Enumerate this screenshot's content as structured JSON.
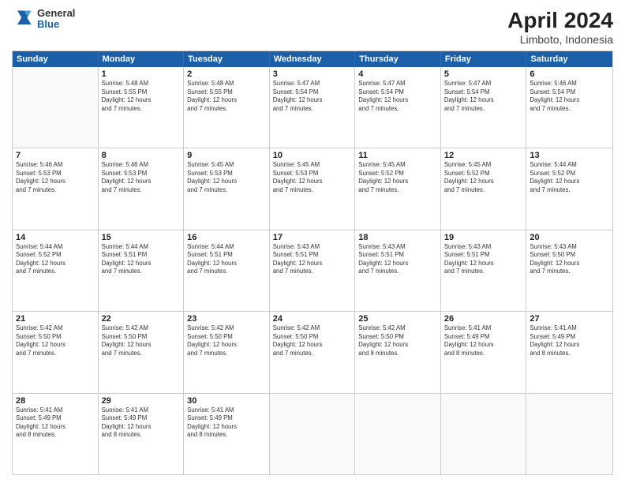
{
  "header": {
    "logo_general": "General",
    "logo_blue": "Blue",
    "title": "April 2024",
    "subtitle": "Limboto, Indonesia"
  },
  "days_of_week": [
    "Sunday",
    "Monday",
    "Tuesday",
    "Wednesday",
    "Thursday",
    "Friday",
    "Saturday"
  ],
  "weeks": [
    [
      {
        "day": "",
        "text": ""
      },
      {
        "day": "1",
        "text": "Sunrise: 5:48 AM\nSunset: 5:55 PM\nDaylight: 12 hours\nand 7 minutes."
      },
      {
        "day": "2",
        "text": "Sunrise: 5:48 AM\nSunset: 5:55 PM\nDaylight: 12 hours\nand 7 minutes."
      },
      {
        "day": "3",
        "text": "Sunrise: 5:47 AM\nSunset: 5:54 PM\nDaylight: 12 hours\nand 7 minutes."
      },
      {
        "day": "4",
        "text": "Sunrise: 5:47 AM\nSunset: 5:54 PM\nDaylight: 12 hours\nand 7 minutes."
      },
      {
        "day": "5",
        "text": "Sunrise: 5:47 AM\nSunset: 5:54 PM\nDaylight: 12 hours\nand 7 minutes."
      },
      {
        "day": "6",
        "text": "Sunrise: 5:46 AM\nSunset: 5:54 PM\nDaylight: 12 hours\nand 7 minutes."
      }
    ],
    [
      {
        "day": "7",
        "text": "Sunrise: 5:46 AM\nSunset: 5:53 PM\nDaylight: 12 hours\nand 7 minutes."
      },
      {
        "day": "8",
        "text": "Sunrise: 5:46 AM\nSunset: 5:53 PM\nDaylight: 12 hours\nand 7 minutes."
      },
      {
        "day": "9",
        "text": "Sunrise: 5:45 AM\nSunset: 5:53 PM\nDaylight: 12 hours\nand 7 minutes."
      },
      {
        "day": "10",
        "text": "Sunrise: 5:45 AM\nSunset: 5:53 PM\nDaylight: 12 hours\nand 7 minutes."
      },
      {
        "day": "11",
        "text": "Sunrise: 5:45 AM\nSunset: 5:52 PM\nDaylight: 12 hours\nand 7 minutes."
      },
      {
        "day": "12",
        "text": "Sunrise: 5:45 AM\nSunset: 5:52 PM\nDaylight: 12 hours\nand 7 minutes."
      },
      {
        "day": "13",
        "text": "Sunrise: 5:44 AM\nSunset: 5:52 PM\nDaylight: 12 hours\nand 7 minutes."
      }
    ],
    [
      {
        "day": "14",
        "text": "Sunrise: 5:44 AM\nSunset: 5:52 PM\nDaylight: 12 hours\nand 7 minutes."
      },
      {
        "day": "15",
        "text": "Sunrise: 5:44 AM\nSunset: 5:51 PM\nDaylight: 12 hours\nand 7 minutes."
      },
      {
        "day": "16",
        "text": "Sunrise: 5:44 AM\nSunset: 5:51 PM\nDaylight: 12 hours\nand 7 minutes."
      },
      {
        "day": "17",
        "text": "Sunrise: 5:43 AM\nSunset: 5:51 PM\nDaylight: 12 hours\nand 7 minutes."
      },
      {
        "day": "18",
        "text": "Sunrise: 5:43 AM\nSunset: 5:51 PM\nDaylight: 12 hours\nand 7 minutes."
      },
      {
        "day": "19",
        "text": "Sunrise: 5:43 AM\nSunset: 5:51 PM\nDaylight: 12 hours\nand 7 minutes."
      },
      {
        "day": "20",
        "text": "Sunrise: 5:43 AM\nSunset: 5:50 PM\nDaylight: 12 hours\nand 7 minutes."
      }
    ],
    [
      {
        "day": "21",
        "text": "Sunrise: 5:42 AM\nSunset: 5:50 PM\nDaylight: 12 hours\nand 7 minutes."
      },
      {
        "day": "22",
        "text": "Sunrise: 5:42 AM\nSunset: 5:50 PM\nDaylight: 12 hours\nand 7 minutes."
      },
      {
        "day": "23",
        "text": "Sunrise: 5:42 AM\nSunset: 5:50 PM\nDaylight: 12 hours\nand 7 minutes."
      },
      {
        "day": "24",
        "text": "Sunrise: 5:42 AM\nSunset: 5:50 PM\nDaylight: 12 hours\nand 7 minutes."
      },
      {
        "day": "25",
        "text": "Sunrise: 5:42 AM\nSunset: 5:50 PM\nDaylight: 12 hours\nand 8 minutes."
      },
      {
        "day": "26",
        "text": "Sunrise: 5:41 AM\nSunset: 5:49 PM\nDaylight: 12 hours\nand 8 minutes."
      },
      {
        "day": "27",
        "text": "Sunrise: 5:41 AM\nSunset: 5:49 PM\nDaylight: 12 hours\nand 8 minutes."
      }
    ],
    [
      {
        "day": "28",
        "text": "Sunrise: 5:41 AM\nSunset: 5:49 PM\nDaylight: 12 hours\nand 8 minutes."
      },
      {
        "day": "29",
        "text": "Sunrise: 5:41 AM\nSunset: 5:49 PM\nDaylight: 12 hours\nand 8 minutes."
      },
      {
        "day": "30",
        "text": "Sunrise: 5:41 AM\nSunset: 5:49 PM\nDaylight: 12 hours\nand 8 minutes."
      },
      {
        "day": "",
        "text": ""
      },
      {
        "day": "",
        "text": ""
      },
      {
        "day": "",
        "text": ""
      },
      {
        "day": "",
        "text": ""
      }
    ]
  ]
}
